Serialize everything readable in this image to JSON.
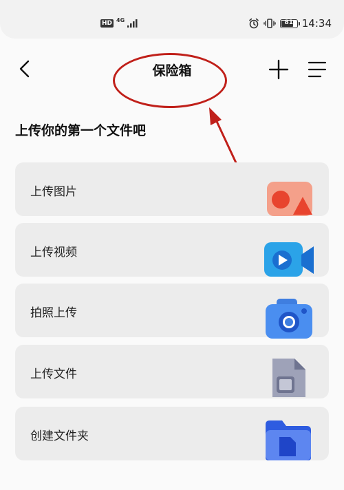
{
  "status_bar": {
    "hd_badge": "HD",
    "network": "4G",
    "battery": "81",
    "battery_level": 0.81,
    "time": "14:34"
  },
  "header": {
    "title": "保险箱",
    "back_icon": "chevron-left-icon",
    "add_icon": "plus-icon",
    "menu_icon": "hamburger-menu-icon"
  },
  "section_title": "上传你的第一个文件吧",
  "actions": [
    {
      "label": "上传图片",
      "icon": "image-icon",
      "color": "#f0735a"
    },
    {
      "label": "上传视频",
      "icon": "video-camera-icon",
      "color": "#2ba3e8"
    },
    {
      "label": "拍照上传",
      "icon": "camera-icon",
      "color": "#3f7ee0"
    },
    {
      "label": "上传文件",
      "icon": "file-icon",
      "color": "#8a8fa8"
    },
    {
      "label": "创建文件夹",
      "icon": "folder-icon",
      "color": "#2e5ce0"
    }
  ],
  "annotation_color": "#c0201a"
}
